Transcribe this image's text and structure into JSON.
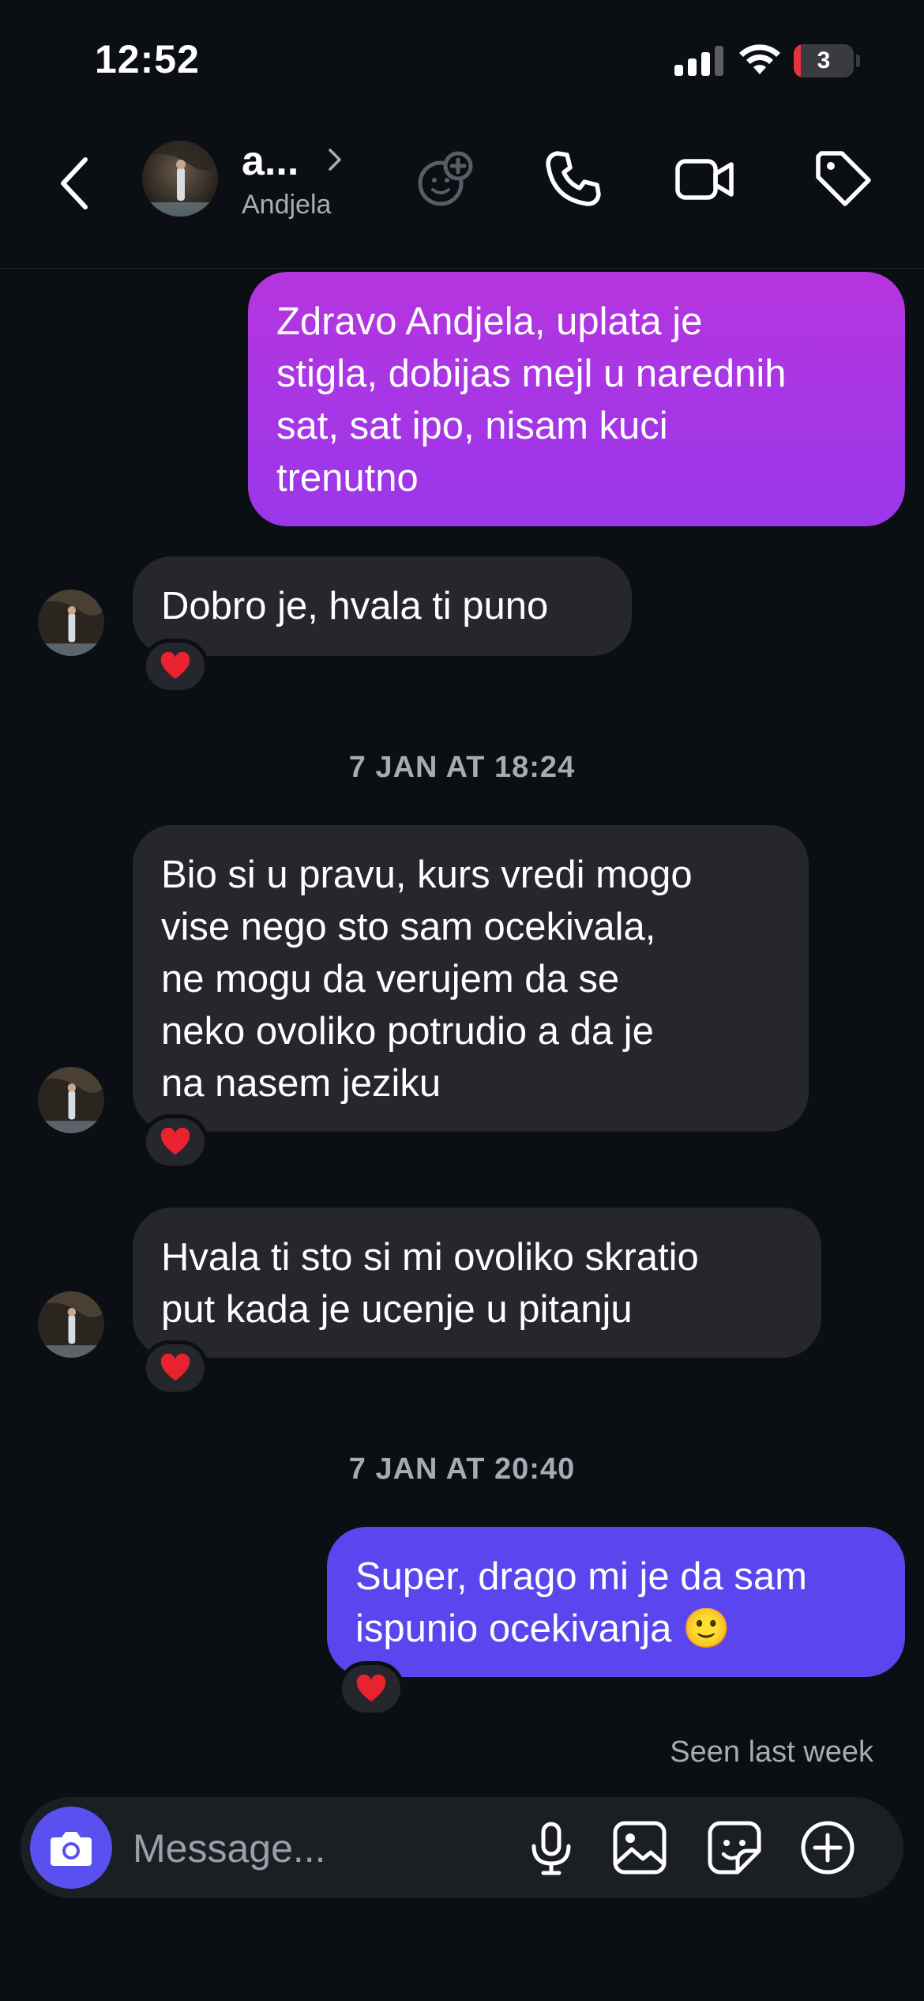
{
  "status_bar": {
    "time": "12:52",
    "battery_level": "3",
    "battery_fraction": 0.03
  },
  "header": {
    "name": "a...",
    "subtitle": "Andjela",
    "icons": [
      "back-icon",
      "chevron-right-icon",
      "add-effect-icon",
      "phone-icon",
      "video-icon",
      "tag-icon"
    ]
  },
  "messages": [
    {
      "direction": "outgoing",
      "text": "Zdravo Andjela, uplata je\nstigla, dobijas mejl u narednih\nsat, sat ipo, nisam kuci\ntrenutno"
    },
    {
      "direction": "incoming",
      "text": "Dobro je, hvala ti puno",
      "reaction": "heart"
    },
    {
      "timestamp": "7 JAN AT 18:24"
    },
    {
      "direction": "incoming",
      "text": "Bio si u pravu, kurs vredi mogo\nvise nego sto sam ocekivala,\nne mogu da verujem da se\nneko ovoliko potrudio a da je\nna nasem jeziku",
      "reaction": "heart"
    },
    {
      "direction": "incoming",
      "text": "Hvala ti sto si mi ovoliko skratio\nput kada je ucenje u pitanju",
      "reaction": "heart"
    },
    {
      "timestamp": "7 JAN AT 20:40"
    },
    {
      "direction": "outgoing",
      "text": "Super, drago mi je da sam\nispunio ocekivanja 🙂",
      "reaction": "heart"
    }
  ],
  "seen_text": "Seen last week",
  "composer": {
    "placeholder": "Message...",
    "icons": [
      "camera-icon",
      "microphone-icon",
      "gallery-icon",
      "sticker-icon",
      "plus-icon"
    ]
  },
  "colors": {
    "background": "#0b0e13",
    "incoming_bubble": "#25272c",
    "outgoing_gradient_start": "#b535df",
    "outgoing_gradient_end": "#9a37ea",
    "outgoing_bubble_2": "#5b45ee",
    "camera_button": "#5a50f0",
    "heart": "#e8232f"
  }
}
